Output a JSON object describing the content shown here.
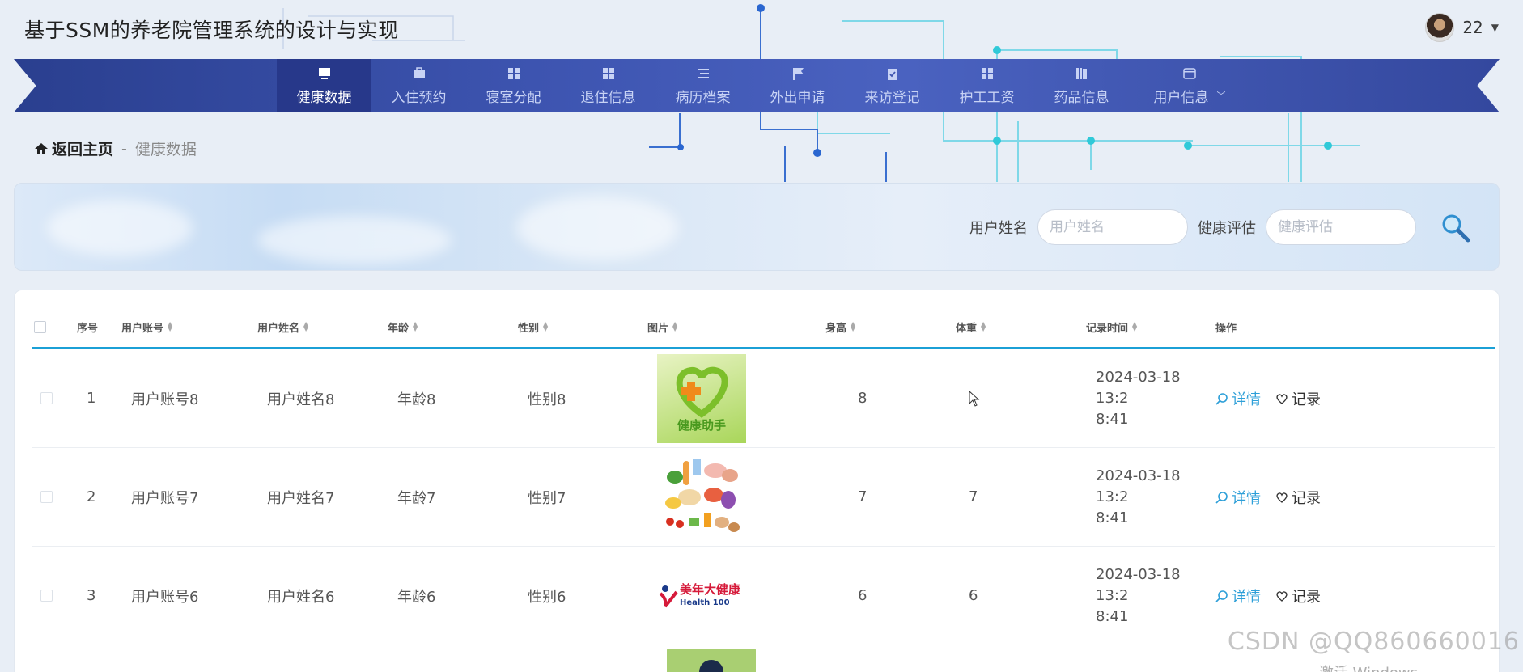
{
  "header": {
    "site_title": "基于SSM的养老院管理系统的设计与实现",
    "user_name": "22"
  },
  "nav": {
    "items": [
      {
        "label": "健康数据",
        "icon": "monitor-icon",
        "active": true
      },
      {
        "label": "入住预约",
        "icon": "briefcase-icon"
      },
      {
        "label": "寝室分配",
        "icon": "grid-icon"
      },
      {
        "label": "退住信息",
        "icon": "grid-icon"
      },
      {
        "label": "病历档案",
        "icon": "list-icon"
      },
      {
        "label": "外出申请",
        "icon": "flag-icon"
      },
      {
        "label": "来访登记",
        "icon": "clipboard-check-icon"
      },
      {
        "label": "护工工资",
        "icon": "grid-icon"
      },
      {
        "label": "药品信息",
        "icon": "books-icon"
      },
      {
        "label": "用户信息",
        "icon": "card-icon"
      }
    ]
  },
  "breadcrumb": {
    "home": "返回主页",
    "separator": "-",
    "current": "健康数据"
  },
  "search": {
    "name_label": "用户姓名",
    "name_placeholder": "用户姓名",
    "eval_label": "健康评估",
    "eval_placeholder": "健康评估"
  },
  "table": {
    "headers": {
      "index": "序号",
      "account": "用户账号",
      "name": "用户姓名",
      "age": "年龄",
      "sex": "性别",
      "image": "图片",
      "height": "身高",
      "weight": "体重",
      "time": "记录时间",
      "ops": "操作"
    },
    "rows": [
      {
        "index": "1",
        "account": "用户账号8",
        "name": "用户姓名8",
        "age": "年龄8",
        "sex": "性别8",
        "image": "health-helper-logo",
        "height": "8",
        "weight": "",
        "time_line1": "2024-03-18 13:2",
        "time_line2": "8:41",
        "detail": "详情",
        "record": "记录"
      },
      {
        "index": "2",
        "account": "用户账号7",
        "name": "用户姓名7",
        "age": "年龄7",
        "sex": "性别7",
        "image": "food-illustration",
        "height": "7",
        "weight": "7",
        "time_line1": "2024-03-18 13:2",
        "time_line2": "8:41",
        "detail": "详情",
        "record": "记录"
      },
      {
        "index": "3",
        "account": "用户账号6",
        "name": "用户姓名6",
        "age": "年龄6",
        "sex": "性别6",
        "image": "health100-logo",
        "height": "6",
        "weight": "6",
        "time_line1": "2024-03-18 13:2",
        "time_line2": "8:41",
        "detail": "详情",
        "record": "记录"
      }
    ]
  },
  "logos": {
    "health_helper": "健康助手",
    "health100_cn": "美年大健康",
    "health100_en": "Health 100"
  },
  "watermark": "CSDN @QQ860660016",
  "os_overlay": "激活 Windows",
  "colors": {
    "nav_bg": "#3d54b0",
    "nav_active": "#27388a",
    "accent": "#1ba0d6",
    "link": "#2d9fd8"
  }
}
